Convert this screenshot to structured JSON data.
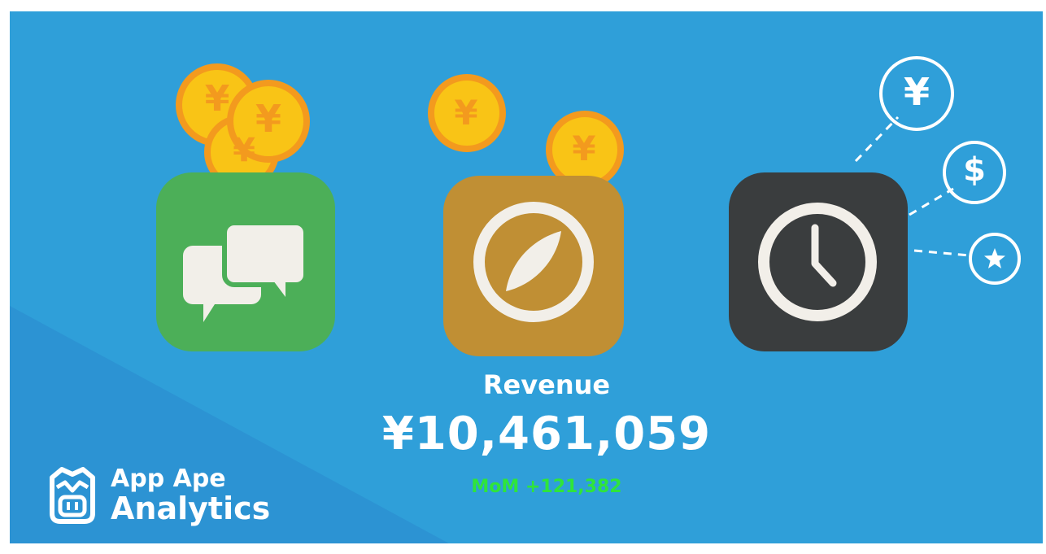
{
  "revenue": {
    "label": "Revenue",
    "value": "¥10,461,059",
    "mom": "MoM +121,382"
  },
  "brand": {
    "line1": "App Ape",
    "line2": "Analytics",
    "logo_icon": "ape-face-icon"
  },
  "coins": {
    "symbol": "¥"
  },
  "bubbles": {
    "yen": "¥",
    "dollar": "$",
    "star_icon": "star-icon"
  },
  "icons": {
    "messaging": "chat-bubbles-icon",
    "browser": "compass-icon",
    "clock": "clock-icon"
  },
  "colors": {
    "background": "#2f9fd9",
    "messaging_tile": "#4caf58",
    "browser_tile": "#c08f34",
    "clock_tile": "#3a3d3e",
    "coin_fill": "#f9c416",
    "coin_rim": "#f39a1e",
    "mom_green": "#2fe53a"
  }
}
